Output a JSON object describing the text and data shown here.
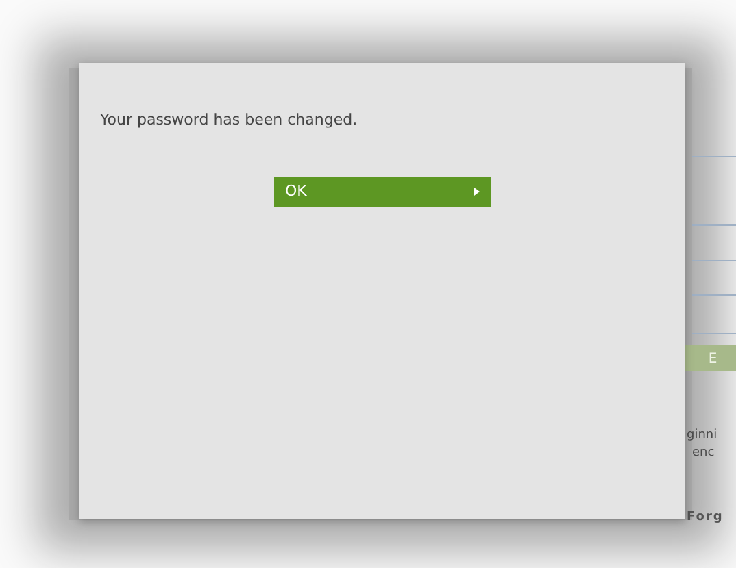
{
  "background": {
    "button_label": "E",
    "texts": [
      "ginni",
      "enc",
      "Forg"
    ]
  },
  "dialog": {
    "message": "Your password has been changed.",
    "button": {
      "label": "OK"
    }
  }
}
